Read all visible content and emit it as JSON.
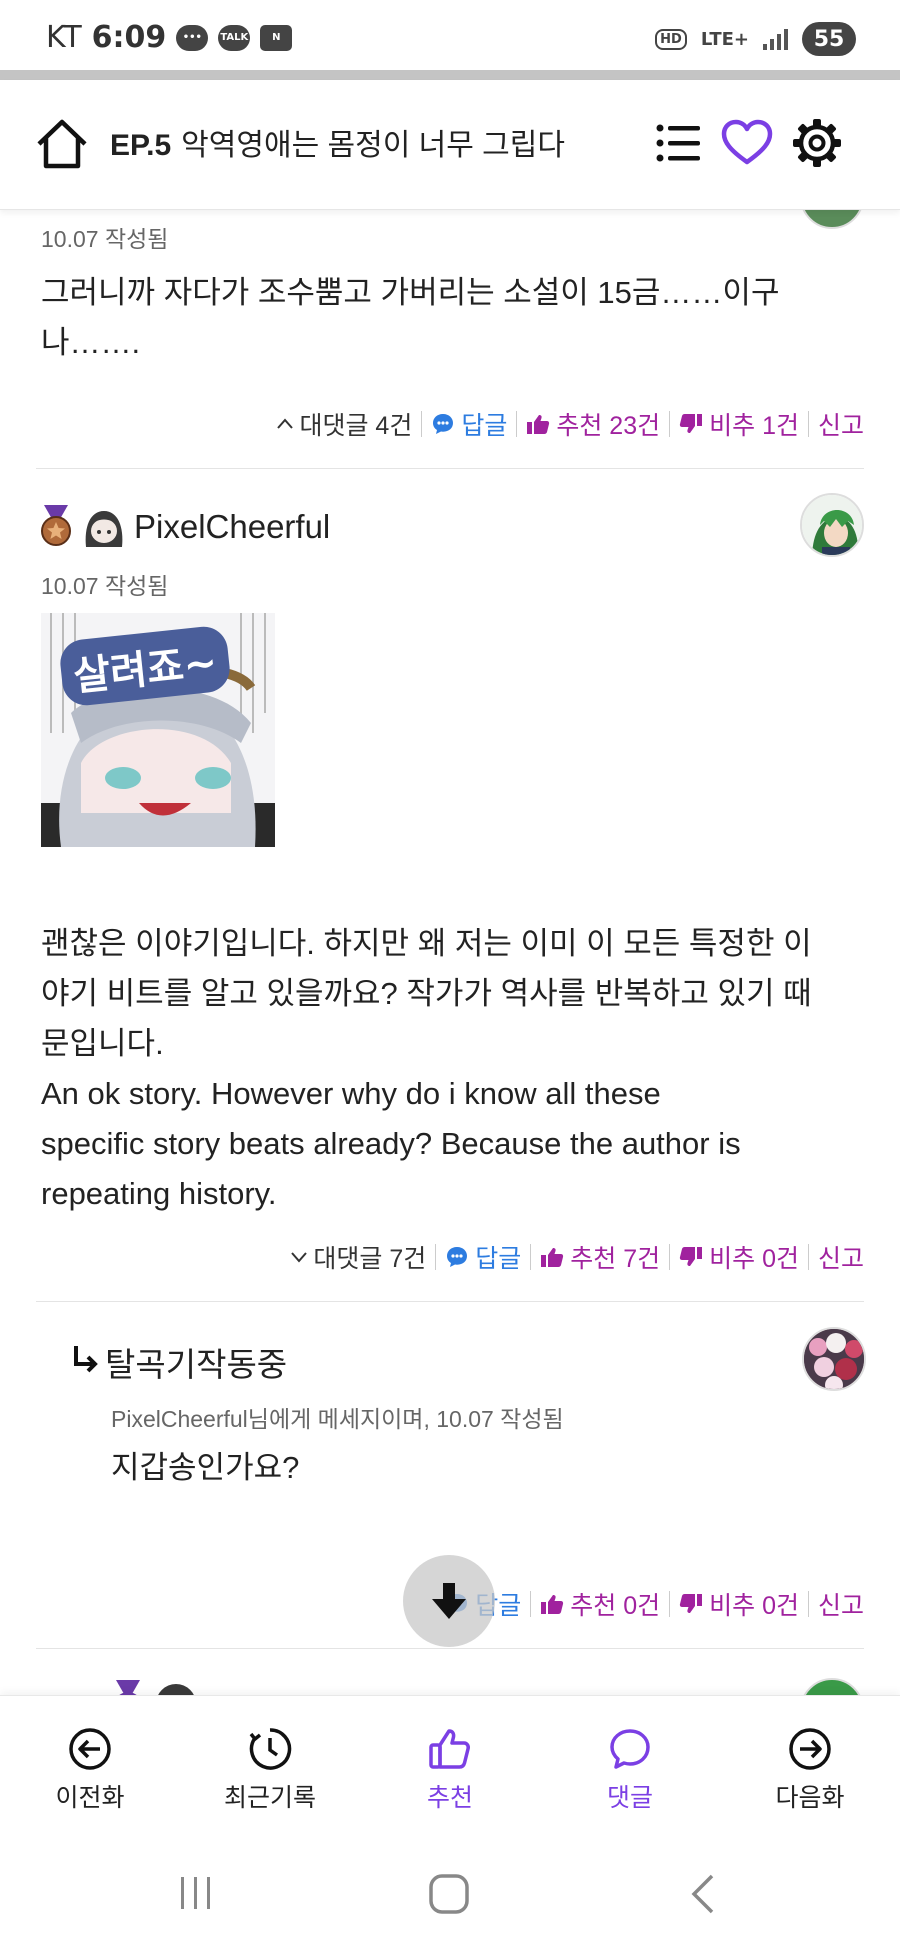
{
  "status_bar": {
    "carrier": "KT",
    "time": "6:09",
    "notif_talk": "TALK",
    "notif_n": "N",
    "hd": "HD",
    "network": "LTE+",
    "battery": "55"
  },
  "reading_progress_fraction": 1.0,
  "header": {
    "episode": "EP.5",
    "title": "악역영애는 몸정이 너무 그립다"
  },
  "comments": [
    {
      "date": "10.07 작성됨",
      "text_lines": [
        "그러니까 자다가 조수뿜고 가버리는 소설이 15금……이구",
        "나……."
      ],
      "replies_toggle": "대댓글 4건",
      "reply_label": "답글",
      "recommend": "추천 23건",
      "dislike": "비추 1건",
      "report": "신고"
    },
    {
      "username": "PixelCheerful",
      "date": "10.07 작성됨",
      "sticker_text": "살려죠~",
      "text_lines": [
        "괜찮은 이야기입니다. 하지만 왜 저는 이미 이 모든 특정한 이",
        "야기 비트를 알고 있을까요? 작가가 역사를 반복하고 있기 때",
        "문입니다.",
        "An ok story. However why do i know all these",
        "specific story beats already? Because the author is",
        "repeating history."
      ],
      "replies_toggle": "대댓글 7건",
      "reply_label": "답글",
      "recommend": "추천 7건",
      "dislike": "비추 0건",
      "report": "신고"
    },
    {
      "username": "탈곡기작동중",
      "meta": "PixelCheerful님에게 메세지이며, 10.07 작성됨",
      "text": "지갑송인가요?",
      "reply_label": "답글",
      "recommend": "추천 0건",
      "dislike": "비추 0건",
      "report": "신고"
    }
  ],
  "bottom_nav": [
    {
      "label": "이전화",
      "icon": "arrow-left-circle-icon"
    },
    {
      "label": "최근기록",
      "icon": "clock-icon"
    },
    {
      "label": "추천",
      "icon": "thumbs-up-icon"
    },
    {
      "label": "댓글",
      "icon": "chat-bubble-icon"
    },
    {
      "label": "다음화",
      "icon": "arrow-right-circle-icon"
    }
  ],
  "colors": {
    "accent_purple": "#7b3fe4",
    "recommend_magenta": "#a0229e",
    "reply_blue": "#2d7ce0"
  }
}
